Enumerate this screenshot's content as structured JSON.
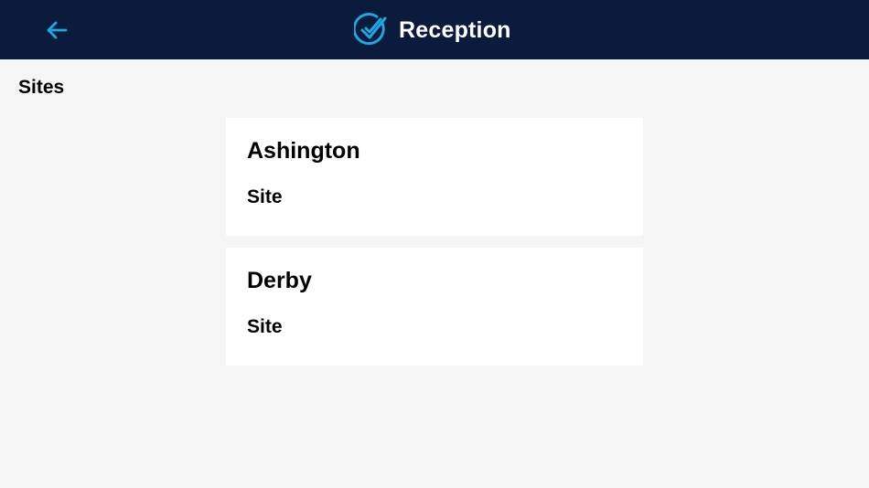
{
  "header": {
    "title": "Reception",
    "back_icon": "arrow-left-icon",
    "logo_icon": "check-circle-icon",
    "accent_color": "#1ea7e1",
    "background_color": "#0b1b3b"
  },
  "page": {
    "section_title": "Sites",
    "background_color": "#f5f5f5"
  },
  "sites": [
    {
      "name": "Ashington",
      "type": "Site"
    },
    {
      "name": "Derby",
      "type": "Site"
    }
  ]
}
